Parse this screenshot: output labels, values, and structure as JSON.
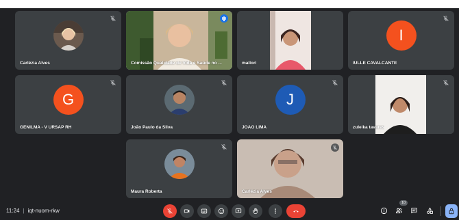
{
  "participants": [
    {
      "name": "Carlézia Alves",
      "type": "photo-avatar",
      "muted": true
    },
    {
      "name": "Comissão Qualidade de Vida e Saúde no ...",
      "type": "video",
      "muted": false,
      "speaking": true
    },
    {
      "name": "mallori",
      "type": "video",
      "muted": false
    },
    {
      "name": "IULLE CAVALCANTE",
      "type": "letter-avatar",
      "initial": "I",
      "color": "#f4511e",
      "muted": true
    },
    {
      "name": "GENILMA - V URSAP RH",
      "type": "letter-avatar",
      "initial": "G",
      "color": "#f4511e",
      "muted": true
    },
    {
      "name": "João Paulo da Silva",
      "type": "photo-avatar",
      "muted": true
    },
    {
      "name": "JOÃO LIMA",
      "type": "letter-avatar",
      "initial": "J",
      "color": "#1e5bb5",
      "muted": true
    },
    {
      "name": "zuleika tavares",
      "type": "video",
      "muted": true
    },
    {
      "name": "Maura Roberta",
      "type": "photo-avatar",
      "muted": true
    },
    {
      "name": "Carlézia Alves",
      "type": "video",
      "muted": true
    }
  ],
  "meeting": {
    "time": "11:24",
    "separator": "|",
    "code": "iqt-nuom-rkw"
  },
  "controls": [
    "mic-off-icon",
    "camera-icon",
    "captions-icon",
    "emoji-icon",
    "present-icon",
    "raise-hand-icon",
    "more-options-icon",
    "end-call-icon"
  ],
  "right_controls": {
    "participant_count": "10"
  },
  "colors": {
    "background": "#202124",
    "tile": "#3c4043",
    "accent": "#8ab4f8",
    "danger": "#ea4335"
  }
}
